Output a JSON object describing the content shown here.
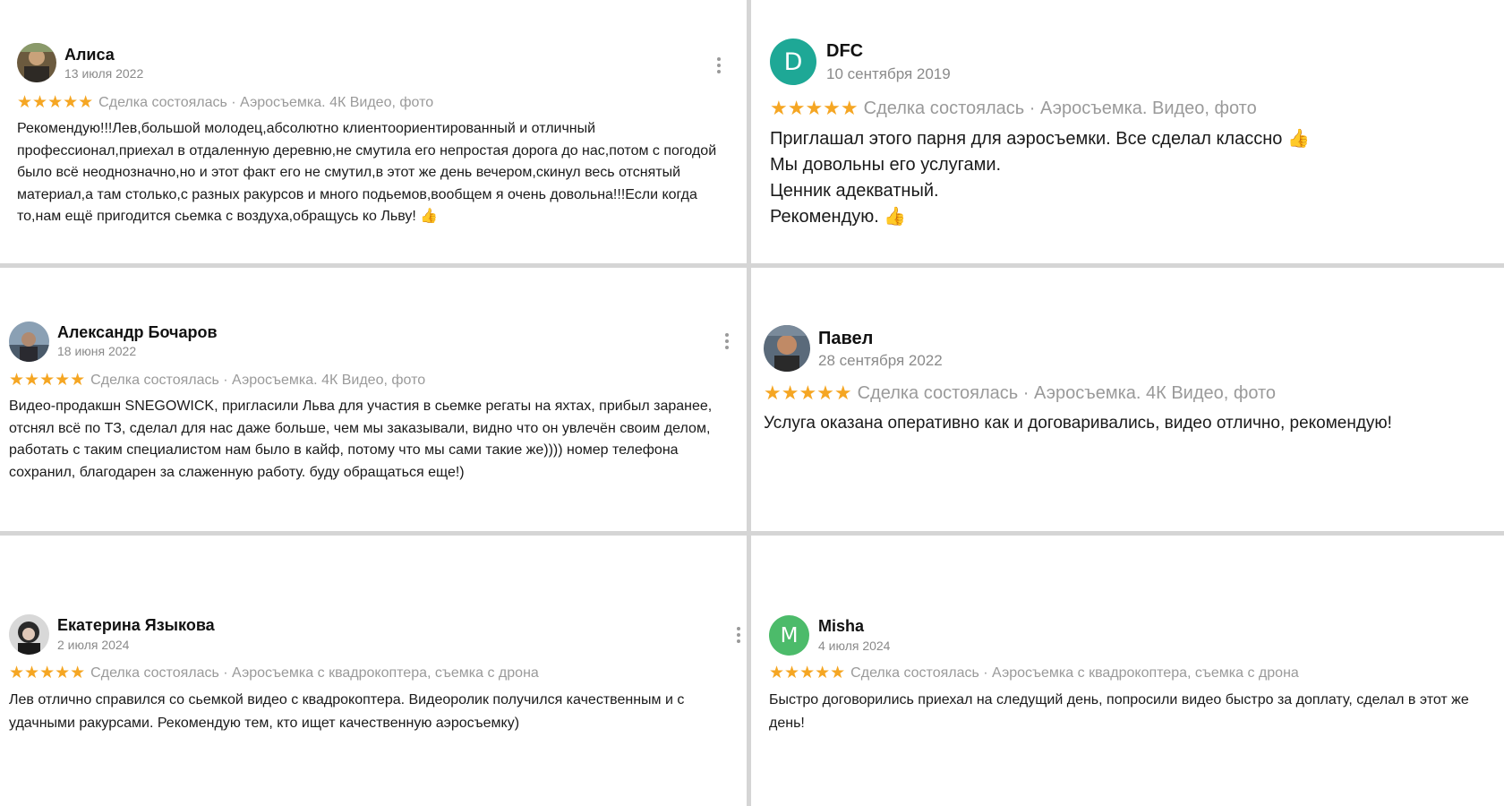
{
  "reviews": [
    {
      "name": "Алиса",
      "date": "13 июля 2022",
      "stars": "★★★★★",
      "deal": "Сделка состоялась · Аэросъемка. 4К Видео, фото",
      "text": "Рекомендую!!!Лев,большой молодец,абсолютно клиентоориентированный и отличный профессионал,приехал в отдаленную деревню,не смутила его непростая дорога до нас,потом с погодой было всё неоднозначно,но и этот факт его не смутил,в этот же день вечером,скинул весь отснятый материал,а там столько,с разных ракурсов и много подьемов,вообщем я очень довольна!!!Если когда то,нам ещё пригодится сьемка с воздуха,обращусь ко Льву! 👍",
      "avatar_icon": "photo-avatar",
      "avatar_color": "#5a4a3a"
    },
    {
      "name": "DFC",
      "date": "10 сентября 2019",
      "stars": "★★★★★",
      "deal": "Сделка состоялась · Аэросъемка. Видео, фото",
      "lines": [
        "Приглашал этого парня для аэросъемки. Все сделал классно 👍",
        "Мы довольны его услугами.",
        "Ценник адекватный.",
        "Рекомендую. 👍"
      ],
      "avatar_letter": "D",
      "avatar_color": "#1ea896"
    },
    {
      "name": "Александр Бочаров",
      "date": "18 июня 2022",
      "stars": "★★★★★",
      "deal": "Сделка состоялась · Аэросъемка. 4К Видео, фото",
      "text": "Видео-продакшн SNEGOWICK, пригласили Льва для участия в сьемке регаты на яхтах, прибыл заранее, отснял всё по ТЗ, сделал для нас даже больше, чем мы заказывали, видно что он увлечён своим делом, работать с таким специалистом нам было в кайф, потому что мы сами такие же)))) номер телефона сохранил, благодарен за слаженную работу. буду обращаться еще!)",
      "avatar_icon": "photo-avatar",
      "avatar_color": "#6a7a8a"
    },
    {
      "name": "Павел",
      "date": "28 сентября 2022",
      "stars": "★★★★★",
      "deal": "Сделка состоялась · Аэросъемка. 4К Видео, фото",
      "text": "Услуга оказана оперативно как и договаривались, видео отлично, рекомендую!",
      "avatar_icon": "photo-avatar",
      "avatar_color": "#7a5a40"
    },
    {
      "name": "Екатерина Языкова",
      "date": "2 июля 2024",
      "stars": "★★★★★",
      "deal": "Сделка состоялась · Аэросъемка с квадрокоптера, съемка с дрона",
      "text": "Лев отлично справился со сьемкой видео с квадрокоптера. Видеоролик получился качественным и с удачными ракурсами. Рекомендую тем, кто ищет качественную аэросъемку)",
      "avatar_icon": "photo-avatar",
      "avatar_color": "#3a3a3a"
    },
    {
      "name": "Misha",
      "date": "4 июля 2024",
      "stars": "★★★★★",
      "deal": "Сделка состоялась · Аэросъемка с квадрокоптера, съемка с дрона",
      "text": "Быстро договорились приехал на следущий день, попросили видео быстро за доплату, сделал в этот же день!",
      "avatar_letter": "M",
      "avatar_color": "#4cbb6a"
    }
  ],
  "colors": {
    "star": "#f5a623",
    "divider": "#d5d5d5"
  }
}
